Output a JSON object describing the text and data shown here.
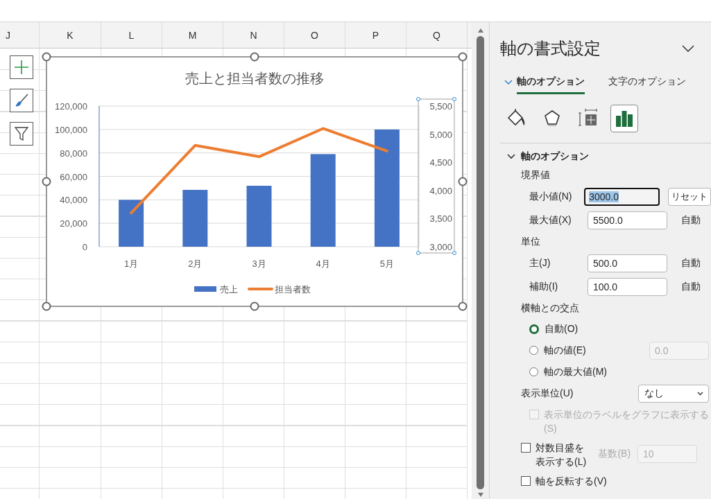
{
  "columns": [
    "J",
    "K",
    "L",
    "M",
    "N",
    "O",
    "P",
    "Q"
  ],
  "chart": {
    "secondary_axis_selected": true,
    "chart_data": {
      "type": "bar",
      "title": "売上と担当者数の推移",
      "categories": [
        "1月",
        "2月",
        "3月",
        "4月",
        "5月"
      ],
      "series": [
        {
          "name": "売上",
          "color": "#4472c4",
          "values": [
            40000,
            48500,
            52000,
            79000,
            100000
          ]
        },
        {
          "name": "担当者数",
          "type": "line",
          "axis": "y2",
          "color": "#ed7d31",
          "values": [
            3600,
            4800,
            4600,
            5100,
            4700
          ]
        }
      ],
      "ylim": [
        0,
        120000
      ],
      "yticks": [
        {
          "value": 0,
          "label": "0"
        },
        {
          "value": 20000,
          "label": "20,000"
        },
        {
          "value": 40000,
          "label": "40,000"
        },
        {
          "value": 60000,
          "label": "60,000"
        },
        {
          "value": 80000,
          "label": "80,000"
        },
        {
          "value": 100000,
          "label": "100,000"
        },
        {
          "value": 120000,
          "label": "120,000"
        }
      ],
      "grid": true,
      "legend": true,
      "y2lim": [
        3000,
        5500
      ],
      "y2ticks": [
        {
          "value": 3000,
          "label": "3,000"
        },
        {
          "value": 3500,
          "label": "3,500"
        },
        {
          "value": 4000,
          "label": "4,000"
        },
        {
          "value": 4500,
          "label": "4,500"
        },
        {
          "value": 5000,
          "label": "5,000"
        },
        {
          "value": 5500,
          "label": "5,500"
        }
      ]
    }
  },
  "panel": {
    "title": "軸の書式設定",
    "tabs": [
      {
        "label": "軸のオプション",
        "selected": true
      },
      {
        "label": "文字のオプション",
        "selected": false
      }
    ],
    "icon_tabs": [
      {
        "kind": "fill",
        "selected": false
      },
      {
        "kind": "effects",
        "selected": false
      },
      {
        "kind": "size",
        "selected": false
      },
      {
        "kind": "options",
        "selected": true
      }
    ],
    "section": {
      "title": "軸のオプション",
      "expanded": true
    },
    "rows": [
      {
        "kind": "heading",
        "label": "境界値"
      },
      {
        "kind": "field",
        "label": "最小値(N)",
        "value": "3000.0",
        "focused": true,
        "button": "リセット"
      },
      {
        "kind": "field",
        "label": "最大値(X)",
        "value": "5500.0",
        "focused": false,
        "note": "自動"
      },
      {
        "kind": "heading",
        "label": "単位"
      },
      {
        "kind": "field",
        "label": "主(J)",
        "value": "500.0",
        "focused": false,
        "note": "自動"
      },
      {
        "kind": "field",
        "label": "補助(I)",
        "value": "100.0",
        "focused": false,
        "note": "自動"
      },
      {
        "kind": "heading",
        "label": "横軸との交点"
      },
      {
        "kind": "radio",
        "label": "自動(O)",
        "selected": true
      },
      {
        "kind": "radio",
        "label": "軸の値(E)",
        "selected": false,
        "field": {
          "value": "0.0",
          "disabled": true
        }
      },
      {
        "kind": "radio",
        "label": "軸の最大値(M)",
        "selected": false
      },
      {
        "kind": "select",
        "label": "表示単位(U)",
        "value": "なし"
      },
      {
        "kind": "checkbox",
        "label": "表示単位のラベルをグラフに表示する(S)",
        "checked": false,
        "disabled": true
      },
      {
        "kind": "checkbox",
        "label": "対数目盛を表示する(L)",
        "checked": false,
        "disabled": false,
        "extra": {
          "label": "基数(B)",
          "value": "10",
          "disabled": true
        }
      },
      {
        "kind": "checkbox",
        "label": "軸を反転する(V)",
        "checked": false,
        "disabled": false
      }
    ]
  }
}
